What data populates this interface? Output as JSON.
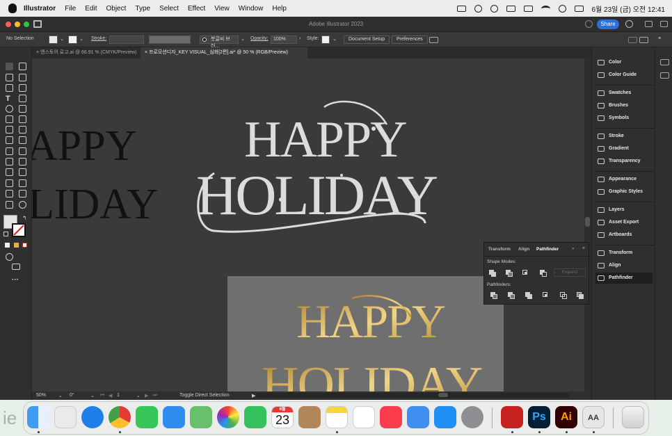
{
  "menubar": {
    "app_name": "Illustrator",
    "items": [
      "File",
      "Edit",
      "Object",
      "Type",
      "Select",
      "Effect",
      "View",
      "Window",
      "Help"
    ],
    "clock": "6월 23일 (금) 오전 12:41"
  },
  "window": {
    "title": "Adobe Illustrator 2023",
    "share_label": "Share"
  },
  "optionsbar": {
    "selection": "No Selection",
    "stroke_label": "Stroke:",
    "brush_value": "붓글씨 브러...",
    "opacity_label": "Opacity:",
    "opacity_value": "100%",
    "style_label": "Style:",
    "document_setup": "Document Setup",
    "preferences": "Preferences"
  },
  "tabs": [
    {
      "label": "앤스토어 로고.ai @ 66.91 % (CMYK/Preview)"
    },
    {
      "label": "프로모션디자_KEY VISUAL_심화[2편].ai* @ 50 % (RGB/Preview) Saving..."
    }
  ],
  "artwork": {
    "line1": "HAPPY",
    "line2": "HOLIDAY",
    "partial_line1": "APPY",
    "partial_line2": "LIDAY",
    "gold_line1": "HAPPY",
    "gold_line2": "HOLIDAY"
  },
  "statusbar": {
    "zoom": "50%",
    "rotation": "0°",
    "artboard": "1",
    "tool_hint": "Toggle Direct Selection"
  },
  "pathfinder": {
    "tabs": [
      "Transform",
      "Align",
      "Pathfinder"
    ],
    "active_tab": "Pathfinder",
    "shape_modes_label": "Shape Modes:",
    "expand_label": "Expand",
    "pathfinders_label": "Pathfinders:"
  },
  "panels": [
    {
      "label": "Color",
      "icon": "color-icon"
    },
    {
      "label": "Color Guide",
      "icon": "color-guide-icon"
    },
    {
      "label": "Swatches",
      "icon": "swatches-icon"
    },
    {
      "label": "Brushes",
      "icon": "brushes-icon"
    },
    {
      "label": "Symbols",
      "icon": "symbols-icon"
    },
    {
      "label": "Stroke",
      "icon": "stroke-icon"
    },
    {
      "label": "Gradient",
      "icon": "gradient-icon"
    },
    {
      "label": "Transparency",
      "icon": "transparency-icon"
    },
    {
      "label": "Appearance",
      "icon": "appearance-icon"
    },
    {
      "label": "Graphic Styles",
      "icon": "graphic-styles-icon"
    },
    {
      "label": "Layers",
      "icon": "layers-icon"
    },
    {
      "label": "Asset Export",
      "icon": "asset-export-icon"
    },
    {
      "label": "Artboards",
      "icon": "artboards-icon"
    },
    {
      "label": "Transform",
      "icon": "transform-icon"
    },
    {
      "label": "Align",
      "icon": "align-icon"
    },
    {
      "label": "Pathfinder",
      "icon": "pathfinder-icon"
    }
  ],
  "dock": {
    "calendar_month": "6월",
    "calendar_day": "23",
    "ps_label": "Ps",
    "ai_label": "Ai",
    "dict_label": "AA"
  },
  "colors": {
    "canvas": "#3a3a3a",
    "artwork_white": "#dcdcdc",
    "accent_blue": "#2a6fdb",
    "gold": "#d9b05a"
  }
}
